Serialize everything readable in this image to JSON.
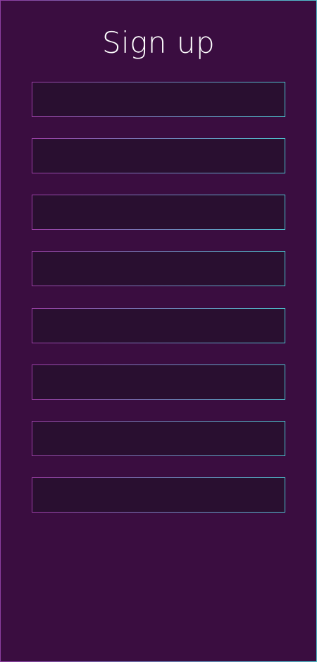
{
  "page": {
    "title": "Sign up"
  },
  "form": {
    "fields": [
      {
        "value": "",
        "placeholder": ""
      },
      {
        "value": "",
        "placeholder": ""
      },
      {
        "value": "",
        "placeholder": ""
      },
      {
        "value": "",
        "placeholder": ""
      },
      {
        "value": "",
        "placeholder": ""
      },
      {
        "value": "",
        "placeholder": ""
      },
      {
        "value": "",
        "placeholder": ""
      },
      {
        "value": "",
        "placeholder": ""
      }
    ]
  },
  "colors": {
    "background": "#3a0d40",
    "field_background": "#290f30",
    "border_start": "#9b3fa6",
    "border_end": "#4ec3cf",
    "title_text": "#ffffff"
  }
}
